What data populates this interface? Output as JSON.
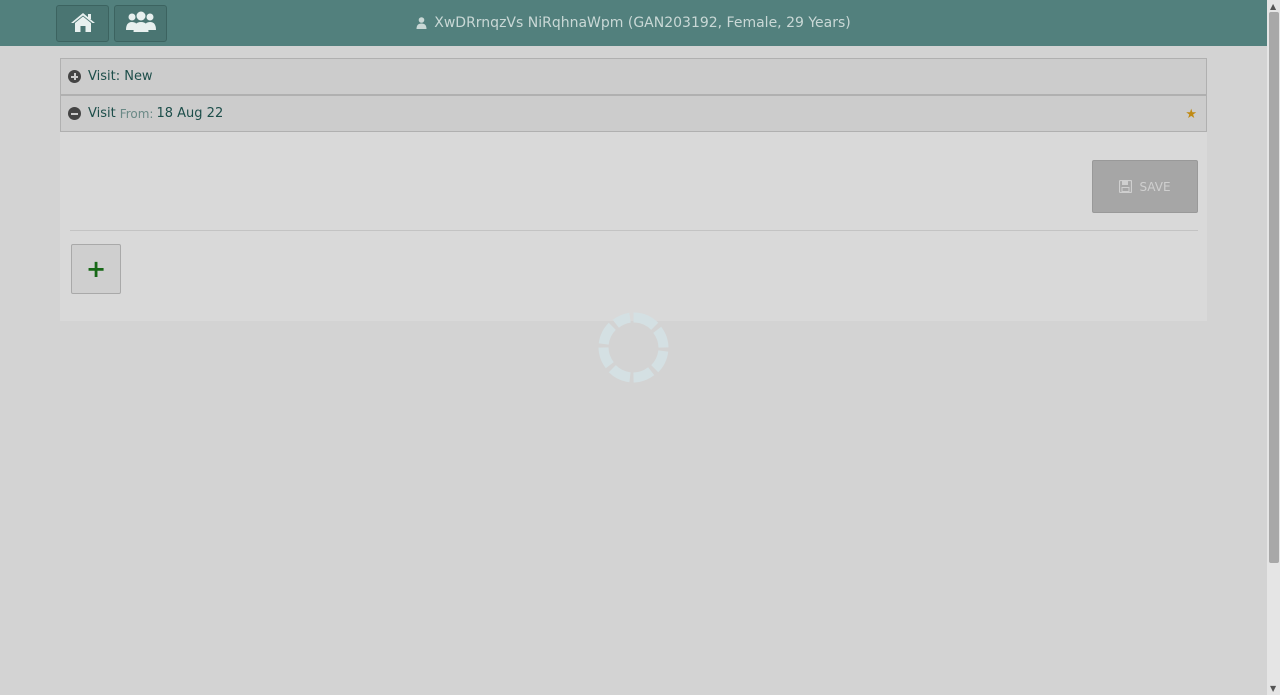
{
  "header": {
    "home_icon": "home-icon",
    "users_icon": "users-icon",
    "patient_info": "XwDRrnqzVs NiRqhnaWpm (GAN203192, Female, 29 Years)"
  },
  "visits": {
    "new_label": "Visit: New",
    "visit_label": "Visit",
    "from_label": "From:",
    "from_date": "18 Aug 22"
  },
  "actions": {
    "save_label": "SAVE",
    "add_symbol": "+"
  },
  "colors": {
    "header": "#52807d",
    "background": "#d3d3d3",
    "accent_star": "#c08a14",
    "add_green": "#176817"
  }
}
